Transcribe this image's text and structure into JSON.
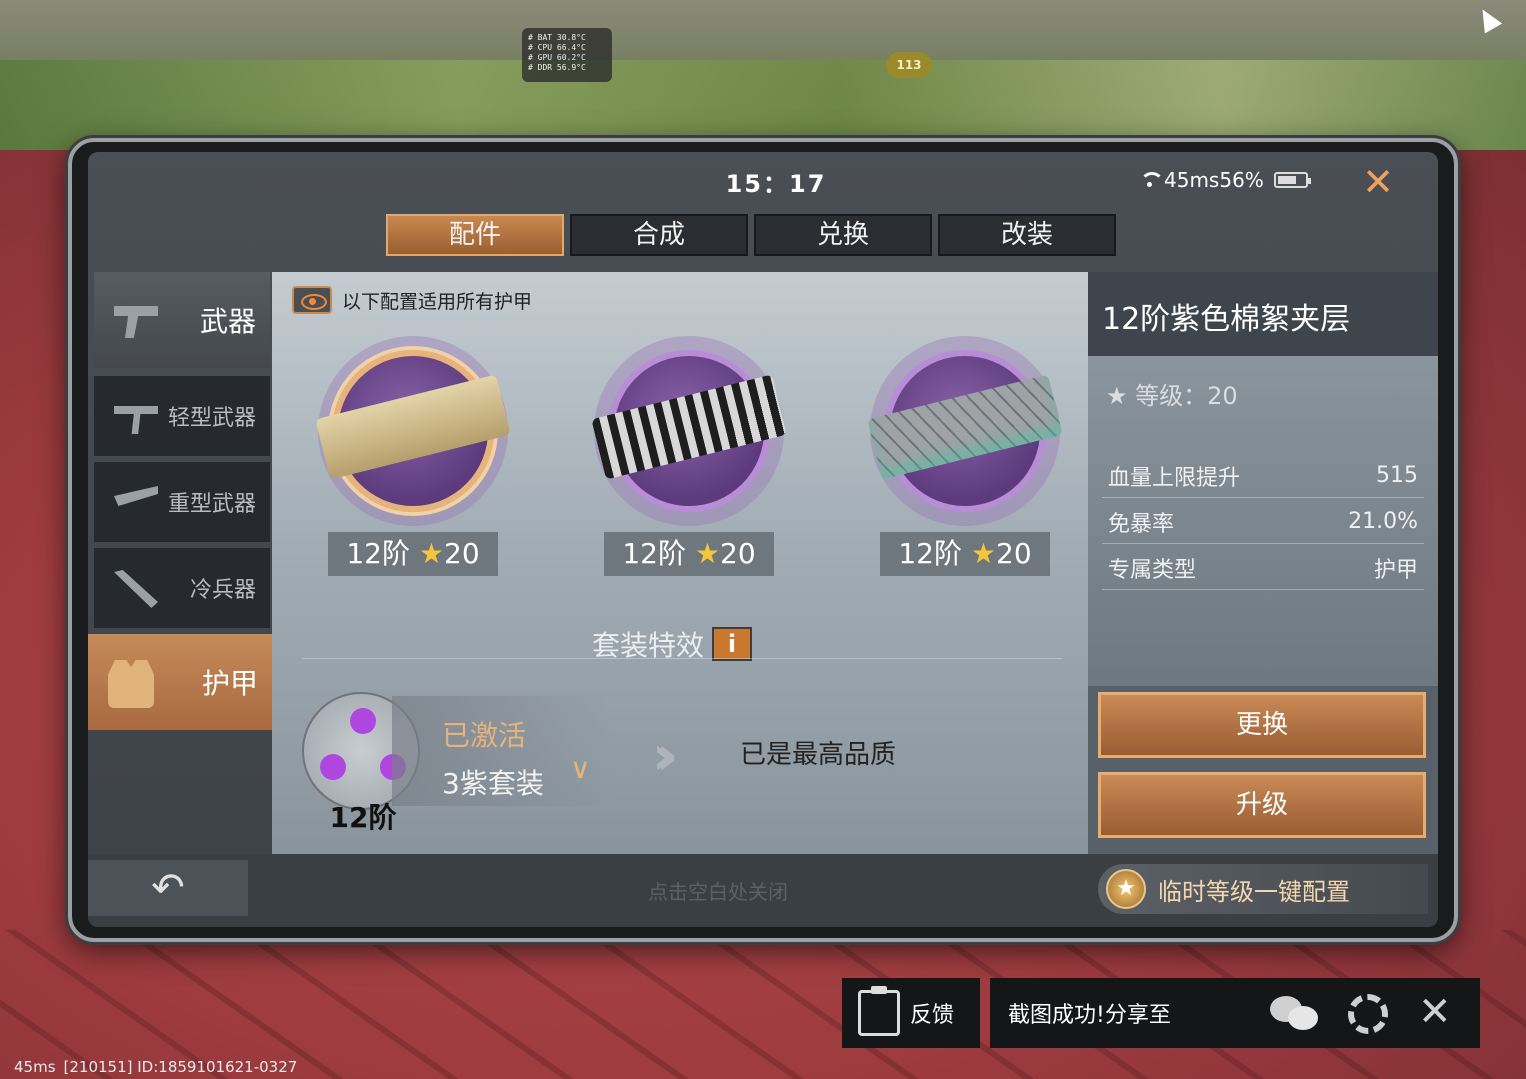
{
  "hud": {
    "temps": [
      "# BAT 30.8°C",
      "# CPU 66.4°C",
      "# GPU 60.2°C",
      "# DDR 56.9°C"
    ],
    "fps": "113"
  },
  "status_bar": {
    "time": "15：17",
    "network": "45ms56%"
  },
  "tabs": [
    {
      "label": "配件",
      "active": true
    },
    {
      "label": "合成",
      "active": false
    },
    {
      "label": "兑换",
      "active": false
    },
    {
      "label": "改装",
      "active": false
    }
  ],
  "sidebar": {
    "header": "武器",
    "items": [
      {
        "label": "轻型武器",
        "icon": "smg-icon"
      },
      {
        "label": "重型武器",
        "icon": "rocket-launcher-icon"
      },
      {
        "label": "冷兵器",
        "icon": "knife-icon"
      },
      {
        "label": "护甲",
        "icon": "vest-icon",
        "active": true
      }
    ]
  },
  "main": {
    "hint": "以下配置适用所有护甲",
    "items": [
      {
        "tier": "12阶",
        "star": "★",
        "level": "20",
        "selected": true
      },
      {
        "tier": "12阶",
        "star": "★",
        "level": "20",
        "selected": false
      },
      {
        "tier": "12阶",
        "star": "★",
        "level": "20",
        "selected": false
      }
    ],
    "set_effect_title": "套装特效",
    "info_glyph": "i",
    "set": {
      "status": "已激活",
      "name": "3紫套装",
      "tier": "12阶",
      "max_quality": "已是最高品质"
    }
  },
  "detail": {
    "title": "12阶紫色棉絮夹层",
    "grade_label": "★ 等级：20",
    "stats": [
      {
        "name": "血量上限提升",
        "value": "515"
      },
      {
        "name": "免暴率",
        "value": "21.0%"
      },
      {
        "name": "专属类型",
        "value": "护甲"
      }
    ],
    "replace_button": "更换",
    "upgrade_button": "升级"
  },
  "bottom": {
    "back_glyph": "↶",
    "close_hint": "点击空白处关闭",
    "quick_config": "临时等级一键配置"
  },
  "toast": {
    "feedback": "反馈",
    "share_text": "截图成功!分享至",
    "close_glyph": "✕"
  },
  "footer": {
    "ping": "45ms",
    "id": "[210151] ID:1859101621-0327"
  },
  "colors": {
    "accent_orange": "#c98a56",
    "purple_quality": "#b046e0",
    "star_gold": "#f5c53b"
  }
}
